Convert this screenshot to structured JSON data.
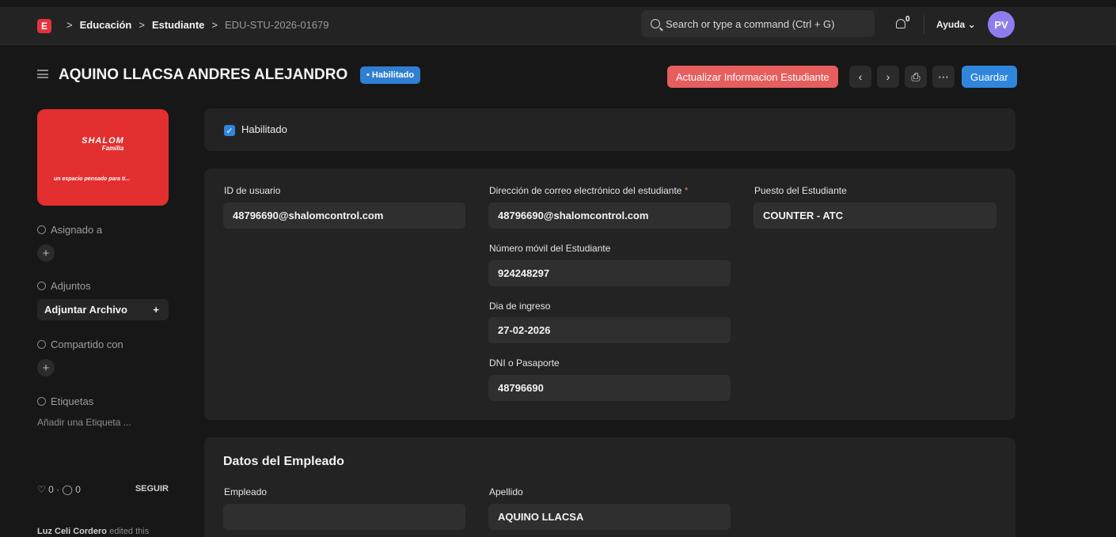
{
  "navbar": {
    "logo_letter": "E",
    "breadcrumbs": [
      "Educación",
      "Estudiante"
    ],
    "current": "EDU-STU-2026-01679",
    "search_placeholder": "Search or type a command (Ctrl + G)",
    "notification_count": "0",
    "help_label": "Ayuda",
    "avatar_initials": "PV"
  },
  "header": {
    "title": "AQUINO LLACSA ANDRES ALEJANDRO",
    "status": "• Habilitado",
    "update_button": "Actualizar Informacion Estudiante",
    "save_button": "Guardar"
  },
  "sidebar": {
    "brand_name": "SHALOM",
    "brand_sub": "Familia",
    "brand_tagline": "un espacio pensado para ti...",
    "assigned_label": "Asignado a",
    "attachments_label": "Adjuntos",
    "attach_button": "Adjuntar Archivo",
    "shared_label": "Compartido con",
    "tags_label": "Etiquetas",
    "tags_placeholder": "Añadir una Etiqueta ...",
    "likes": "0",
    "comments": "0",
    "follow_label": "SEGUIR",
    "activity_user": "Luz Celi Cordero",
    "activity_text": "edited this"
  },
  "form": {
    "enabled_label": "Habilitado",
    "user_id_label": "ID de usuario",
    "user_id_value": "48796690@shalomcontrol.com",
    "email_label": "Dirección de correo electrónico del estudiante",
    "email_value": "48796690@shalomcontrol.com",
    "position_label": "Puesto del Estudiante",
    "position_value": "COUNTER - ATC",
    "mobile_label": "Número móvil del Estudiante",
    "mobile_value": "924248297",
    "join_label": "Dia de ingreso",
    "join_value": "27-02-2026",
    "dni_label": "DNI o Pasaporte",
    "dni_value": "48796690"
  },
  "employee": {
    "section_title": "Datos del Empleado",
    "employee_label": "Empleado",
    "employee_value": "",
    "surname_label": "Apellido",
    "surname_value": "AQUINO LLACSA"
  }
}
